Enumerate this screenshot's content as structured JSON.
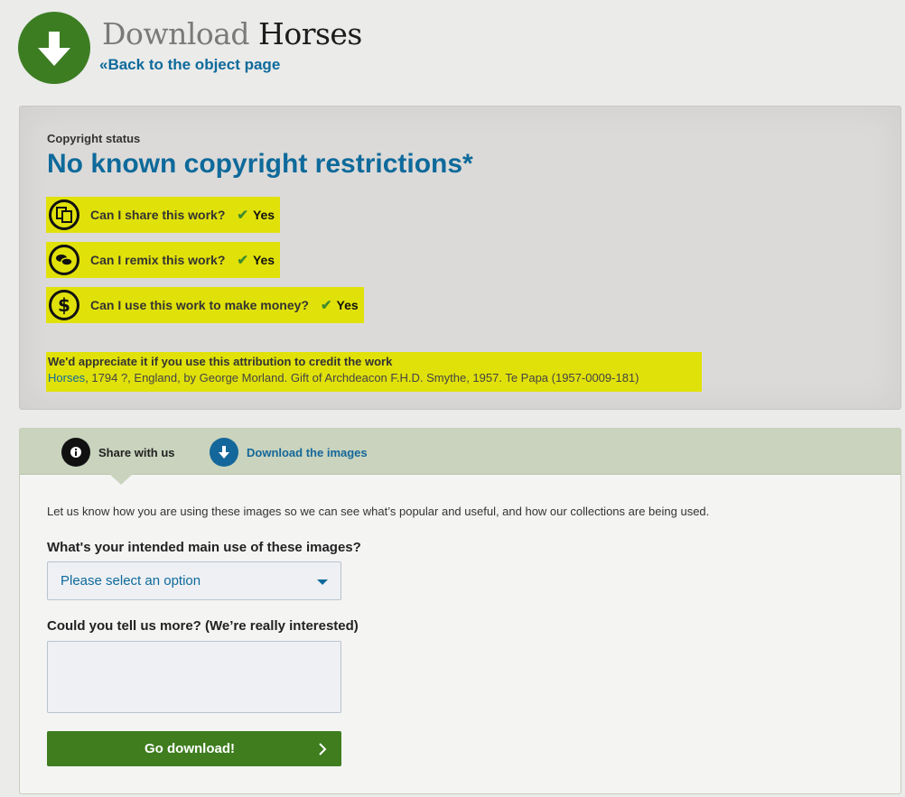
{
  "header": {
    "title_prefix": "Download",
    "title_object": "Horses",
    "back_link": "«Back to the object page",
    "download_icon": "arrow-down-icon"
  },
  "copyright": {
    "label": "Copyright status",
    "status": "No known copyright restrictions*",
    "highlight_color": "#e1e10a",
    "questions": [
      {
        "icon": "share-icon",
        "text": "Can I share this work?",
        "answer": "Yes"
      },
      {
        "icon": "remix-icon",
        "text": "Can I remix this work?",
        "answer": "Yes"
      },
      {
        "icon": "money-icon",
        "text": "Can I use this work to make money?",
        "answer": "Yes"
      }
    ],
    "check_icon": "check-icon",
    "attribution_heading": "We'd appreciate it if you use this attribution to credit the work",
    "attribution_link": "Horses",
    "attribution_rest": ", 1794 ?, England, by George Morland. Gift of Archdeacon F.H.D. Smythe, 1957. Te Papa (1957-0009-181)"
  },
  "tabs": [
    {
      "icon": "info-icon",
      "label": "Share with us"
    },
    {
      "icon": "arrow-down-icon",
      "label": "Download the images"
    }
  ],
  "form": {
    "intro": "Let us know how you are using these images so we can see what’s popular and useful, and how our collections are being used.",
    "q1_label": "What's your intended main use of these images?",
    "select_value": "Please select an option",
    "q2_label": "Could you tell us more? (We’re really interested)",
    "textarea_value": "",
    "submit_label": "Go download!"
  },
  "colors": {
    "brand_green": "#3c7d22",
    "link_blue": "#0e6a9b",
    "tab_bar": "#c9d3bd"
  }
}
